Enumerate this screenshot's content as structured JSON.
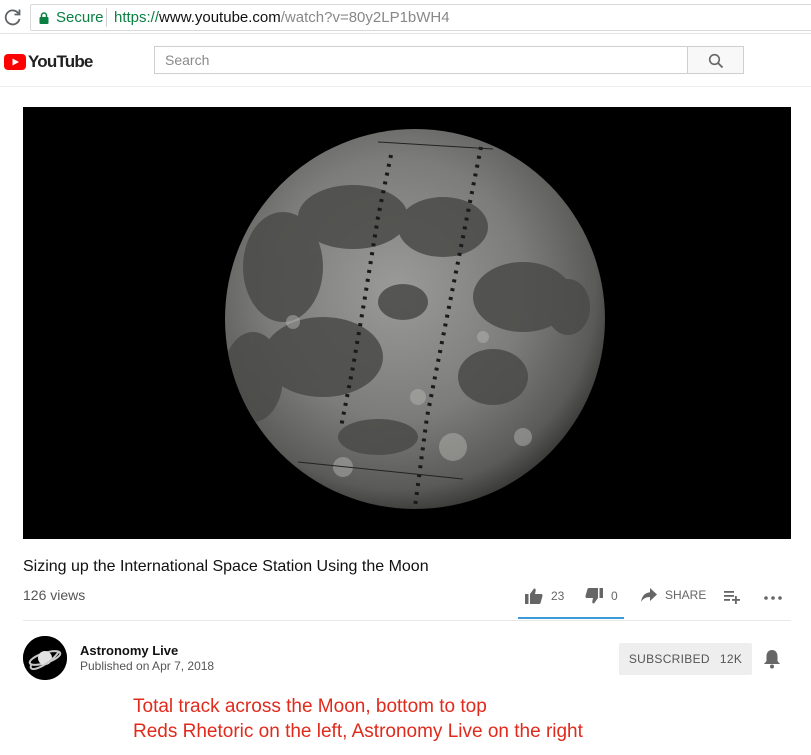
{
  "browser": {
    "secure_label": "Secure",
    "url_protocol": "https://",
    "url_host": "www.youtube.com",
    "url_path": "/watch?v=80y2LP1bWH4"
  },
  "header": {
    "logo_text": "YouTube",
    "search_placeholder": "Search"
  },
  "video": {
    "title": "Sizing up the International Space Station Using the Moon",
    "views": "126 views",
    "likes": "23",
    "dislikes": "0",
    "share_label": "SHARE",
    "like_ratio": 1.0
  },
  "channel": {
    "name": "Astronomy Live",
    "published": "Published on Apr 7, 2018",
    "subscribe_label": "SUBSCRIBED",
    "subscriber_count": "12K"
  },
  "annotation": {
    "line1": "Total track across the Moon, bottom to top",
    "line2": "Reds Rhetoric on the left, Astronomy Live on the right"
  },
  "colors": {
    "secure_green": "#0b8043",
    "youtube_red": "#ff0000",
    "like_bar": "#3e9bd8",
    "annotation_red": "#e02a1c"
  },
  "icons": [
    "reload-icon",
    "lock-icon",
    "youtube-logo-icon",
    "search-icon",
    "thumbs-up-icon",
    "thumbs-down-icon",
    "share-icon",
    "add-to-playlist-icon",
    "more-icon",
    "bell-icon"
  ]
}
